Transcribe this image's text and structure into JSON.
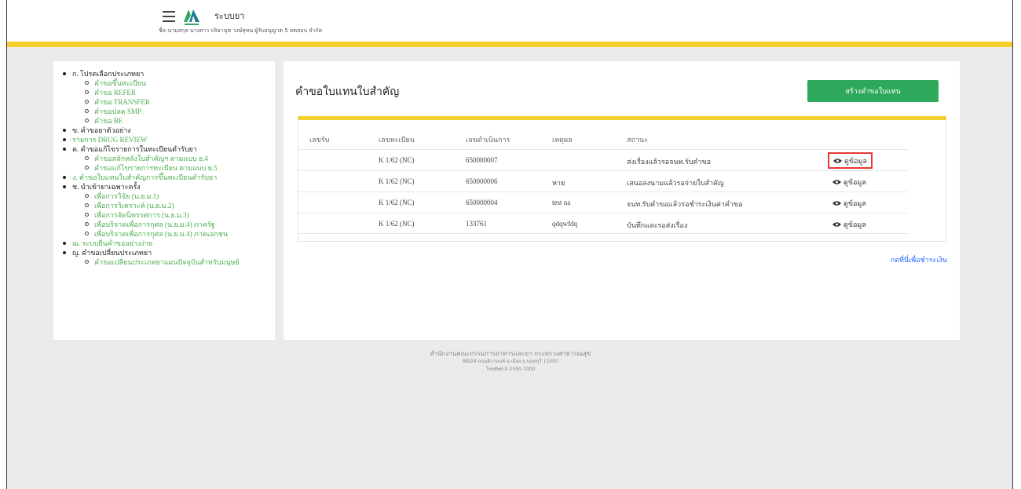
{
  "header": {
    "app_title": "ระบบยา",
    "user_info": "ชื่อ-นามสกุล นางสาว ปริยานุช วงษ์สุขน ผู้รับอนุญาต 5 ทดสอบ จำกัด"
  },
  "sidebar": {
    "sections": [
      {
        "label": "ก. โปรดเลือกประเภทยา",
        "subs": [
          "คำขอขึ้นทะเบียน",
          "คำขอ REFER",
          "คำขอ TRANSFER",
          "คำขอปลด SMP",
          "คำขอ BE"
        ]
      },
      {
        "label": "ข. คำขอยาตัวอย่าง",
        "subs": []
      },
      {
        "label": "รายการ DRUG REVIEW",
        "subs": []
      },
      {
        "label": "ค. คำขอแก้ไขรายการในทะเบียนตำรับยา",
        "subs": [
          "คำขอสลักหลังใบสำคัญฯ ตามแบบ ย.4",
          "คำขอแก้ไขรายการทะเบียน ตามแบบ ย.5"
        ]
      },
      {
        "label": "ง. คำขอใบแทนใบสำคัญการขึ้นทะเบียนตำรับยา",
        "subs": []
      },
      {
        "label": "ช. นำเข้ายาเฉพาะครั้ง",
        "subs": [
          "เพื่อการวิจัย (น.ย.ม.1)",
          "เพื่อการวิเคราะห์ (น.ย.ม.2)",
          "เพื่อการจัดนิทรรศการ (น.ย.ม.3)",
          "เพื่อบริจาคเพื่อการกุศล (น.ย.ม.4) ภาครัฐ",
          "เพื่อบริจาคเพื่อการกุศล (น.ย.ม.4) ภาคเอกชน"
        ]
      },
      {
        "label": "ฌ. ระบบยื่นคำขออย่างง่าย",
        "subs": []
      },
      {
        "label": "ญ. คำขอเปลี่ยนประเภทยา",
        "subs": [
          "คำขอเปลี่ยนประเภทยาแผนปัจจุบันสำหรับมนุษย์"
        ]
      }
    ]
  },
  "main": {
    "title": "คำขอใบแทนใบสำคัญ",
    "create_button": "สร้างคำขอใบแทน",
    "columns": [
      "เลขรับ",
      "เลขทะเบียน",
      "เลขดำเนินการ",
      "เหตุผล",
      "สถานะ",
      ""
    ],
    "rows": [
      {
        "receive_no": "",
        "reg_no": "K 1/62 (NC)",
        "process_no": "650000007",
        "reason": "",
        "status": "ส่งเรื่องแล้วรอจนท.รับคำขอ",
        "action": "ดูข้อมูล"
      },
      {
        "receive_no": "",
        "reg_no": "K 1/62 (NC)",
        "process_no": "650000006",
        "reason": "หาย",
        "status": "เสนอลงนามแล้วรอจ่ายใบสำคัญ",
        "action": "ดูข้อมูล"
      },
      {
        "receive_no": "",
        "reg_no": "K 1/62 (NC)",
        "process_no": "650000004",
        "reason": "test na",
        "status": "จนท.รับคำขอแล้วรอชำระเงินค่าคำขอ",
        "action": "ดูข้อมูล"
      },
      {
        "receive_no": "",
        "reg_no": "K 1/62 (NC)",
        "process_no": "133761",
        "reason": "qdqwfdq",
        "status": "บันทึกและรอส่งเรื่อง",
        "action": "ดูข้อมูล"
      }
    ],
    "payment_link": "กดที่นี่เพื่อชำระเงิน"
  },
  "footer": {
    "org": "สำนักงานคณะกรรมการอาหารและยา กระทรวงสาธารณสุข",
    "address": "88/24 ถนนติวานนท์ อ.เมือง จ.นนทบุรี 11000",
    "phone": "โทรศัพท์ 0-2590-7000"
  },
  "colors": {
    "accent_yellow": "#f4cf2c",
    "button_green": "#2ea85a",
    "link_green": "#4caf50",
    "link_blue": "#2962ff",
    "highlight_red": "#e53935"
  },
  "icons": [
    "hamburger-icon",
    "logo-icon",
    "eye-icon"
  ]
}
